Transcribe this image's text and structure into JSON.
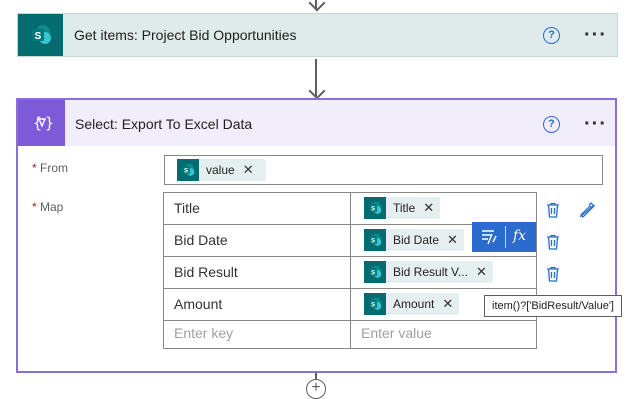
{
  "get_items": {
    "title": "Get items: Project Bid Opportunities",
    "icon": "sharepoint-icon"
  },
  "select": {
    "title": "Select: Export To Excel Data",
    "icon": "data-operation-icon",
    "from_label": "From",
    "map_label": "Map",
    "required_marker": "*",
    "from_token": "value",
    "rows": [
      {
        "key": "Title",
        "value": "Title"
      },
      {
        "key": "Bid Date",
        "value": "Bid Date"
      },
      {
        "key": "Bid Result",
        "value": "Bid Result V..."
      },
      {
        "key": "Amount",
        "value": "Amount"
      }
    ],
    "key_placeholder": "Enter key",
    "value_placeholder": "Enter value"
  },
  "help_glyph": "?",
  "more_glyph": "···",
  "remove_glyph": "✕",
  "fx_label": "fx",
  "tooltip": "item()?['BidResult/Value']",
  "add_glyph": "+",
  "colors": {
    "sharepoint": "#036c70",
    "data_operation": "#7c5ad8",
    "accent": "#2b6bcc"
  }
}
